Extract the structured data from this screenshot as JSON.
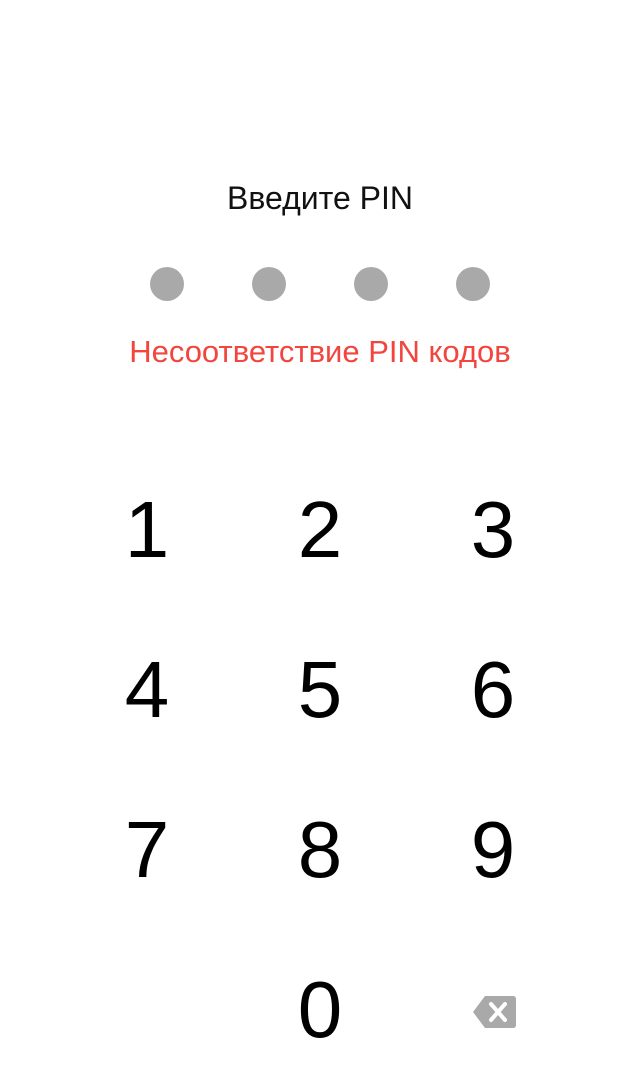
{
  "pin_screen": {
    "title": "Введите PIN",
    "error": "Несоответствие PIN кодов",
    "dot_count": 4,
    "dot_color": "#a9a9a9",
    "error_color": "#f2453d"
  },
  "keypad": {
    "keys": [
      "1",
      "2",
      "3",
      "4",
      "5",
      "6",
      "7",
      "8",
      "9",
      "0"
    ],
    "backspace_icon": "backspace-icon"
  }
}
